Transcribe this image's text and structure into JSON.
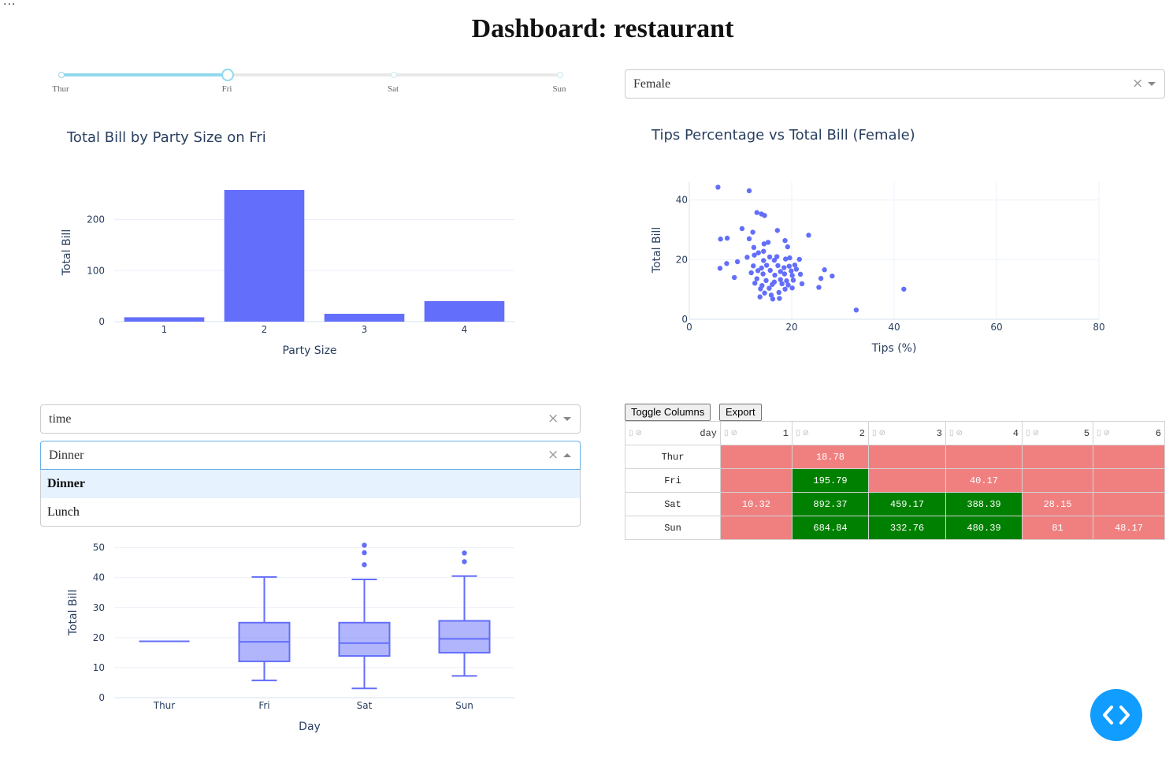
{
  "ellipsis": "...",
  "title": "Dashboard: restaurant",
  "day_slider": {
    "marks": [
      "Thur",
      "Fri",
      "Sat",
      "Sun"
    ],
    "selected": "Fri"
  },
  "sex_dropdown": {
    "value": "Female",
    "clear": "×"
  },
  "time_dropdown": {
    "value": "time",
    "clear": "×"
  },
  "meal_dropdown": {
    "value": "Dinner",
    "clear": "×",
    "options": [
      "Dinner",
      "Lunch"
    ],
    "highlighted": "Dinner"
  },
  "colors": {
    "bar": "#636efa",
    "positive": "#008000",
    "negative": "#f08080",
    "accent": "#119dff"
  },
  "charts": {
    "bar": {
      "type": "bar",
      "title": "Total Bill by Party Size on Fri",
      "xlabel": "Party Size",
      "ylabel": "Total Bill",
      "categories": [
        "1",
        "2",
        "3",
        "4"
      ],
      "values": [
        8.6,
        258,
        15.4,
        40.2
      ],
      "ylim": [
        0,
        258
      ],
      "yticks": [
        0,
        100,
        200
      ]
    },
    "scatter": {
      "type": "scatter",
      "title": "Tips Percentage vs Total Bill (Female)",
      "xlabel": "Tips (%)",
      "ylabel": "Total Bill",
      "xlim": [
        0,
        80
      ],
      "ylim": [
        0,
        46
      ],
      "xticks": [
        0,
        20,
        40,
        60,
        80
      ],
      "yticks": [
        0,
        20,
        40
      ],
      "points": [
        [
          5.6,
          44.3
        ],
        [
          11.7,
          43.1
        ],
        [
          13.2,
          35.8
        ],
        [
          14.1,
          35.3
        ],
        [
          14.7,
          34.8
        ],
        [
          10.3,
          30.4
        ],
        [
          12.4,
          29.2
        ],
        [
          17.2,
          29.8
        ],
        [
          23.3,
          28.2
        ],
        [
          6.1,
          26.9
        ],
        [
          7.4,
          27.2
        ],
        [
          11.7,
          27.0
        ],
        [
          14.6,
          25.3
        ],
        [
          15.4,
          25.8
        ],
        [
          18.7,
          26.4
        ],
        [
          12.6,
          24.1
        ],
        [
          19.2,
          24.3
        ],
        [
          13.5,
          22.3
        ],
        [
          14.5,
          22.8
        ],
        [
          11.3,
          20.8
        ],
        [
          12.7,
          21.5
        ],
        [
          15.7,
          20.9
        ],
        [
          17.1,
          21.0
        ],
        [
          19.6,
          20.6
        ],
        [
          14.5,
          19.7
        ],
        [
          16.6,
          19.8
        ],
        [
          18.8,
          20.2
        ],
        [
          21.5,
          20.1
        ],
        [
          7.3,
          18.7
        ],
        [
          9.4,
          19.3
        ],
        [
          6.0,
          17.1
        ],
        [
          12.5,
          17.9
        ],
        [
          14.1,
          17.2
        ],
        [
          15.1,
          18.1
        ],
        [
          17.3,
          18.0
        ],
        [
          18.5,
          17.3
        ],
        [
          19.5,
          17.8
        ],
        [
          20.6,
          18.2
        ],
        [
          13.4,
          16.3
        ],
        [
          15.8,
          16.4
        ],
        [
          17.8,
          16.0
        ],
        [
          19.9,
          16.2
        ],
        [
          20.9,
          16.8
        ],
        [
          26.4,
          16.6
        ],
        [
          8.8,
          14.0
        ],
        [
          12.1,
          15.6
        ],
        [
          14.4,
          15.2
        ],
        [
          16.7,
          14.8
        ],
        [
          18.6,
          15.2
        ],
        [
          20.1,
          14.7
        ],
        [
          21.7,
          15.1
        ],
        [
          27.9,
          14.5
        ],
        [
          25.7,
          13.7
        ],
        [
          13.2,
          13.6
        ],
        [
          15.0,
          13.0
        ],
        [
          16.6,
          12.5
        ],
        [
          17.8,
          13.3
        ],
        [
          19.0,
          12.9
        ],
        [
          20.3,
          13.1
        ],
        [
          12.8,
          12.1
        ],
        [
          14.2,
          11.3
        ],
        [
          16.2,
          11.7
        ],
        [
          18.1,
          11.9
        ],
        [
          19.3,
          11.5
        ],
        [
          22.0,
          11.9
        ],
        [
          25.3,
          10.7
        ],
        [
          13.9,
          10.2
        ],
        [
          15.6,
          10.4
        ],
        [
          18.7,
          10.1
        ],
        [
          20.1,
          10.5
        ],
        [
          14.7,
          8.8
        ],
        [
          17.5,
          9.0
        ],
        [
          13.8,
          7.5
        ],
        [
          16.0,
          8.1
        ],
        [
          17.6,
          7.0
        ],
        [
          16.3,
          6.8
        ],
        [
          32.6,
          3.1
        ],
        [
          41.9,
          10.1
        ]
      ]
    },
    "box": {
      "type": "box",
      "xlabel": "Day",
      "ylabel": "Total Bill",
      "categories": [
        "Thur",
        "Fri",
        "Sat",
        "Sun"
      ],
      "ylim": [
        0,
        52
      ],
      "yticks": [
        0,
        10,
        20,
        30,
        40,
        50
      ],
      "boxes": [
        {
          "min": 18.78,
          "q1": 18.78,
          "median": 18.78,
          "q3": 18.78,
          "max": 18.78,
          "outliers": []
        },
        {
          "min": 5.75,
          "q1": 12.1,
          "median": 18.6,
          "q3": 25.0,
          "max": 40.2,
          "outliers": []
        },
        {
          "min": 3.07,
          "q1": 13.9,
          "median": 18.2,
          "q3": 25.0,
          "max": 39.4,
          "outliers": [
            44.3,
            48.3,
            50.8
          ]
        },
        {
          "min": 7.25,
          "q1": 15.0,
          "median": 19.6,
          "q3": 25.6,
          "max": 40.5,
          "outliers": [
            45.3,
            48.2
          ]
        }
      ]
    }
  },
  "table": {
    "toggle_label": "Toggle Columns",
    "export_label": "Export",
    "columns": [
      "day",
      "1",
      "2",
      "3",
      "4",
      "5",
      "6"
    ],
    "rows": [
      {
        "day": "Thur",
        "cells": [
          "",
          "18.78",
          "",
          "",
          "",
          ""
        ]
      },
      {
        "day": "Fri",
        "cells": [
          "",
          "195.79",
          "",
          "40.17",
          "",
          ""
        ]
      },
      {
        "day": "Sat",
        "cells": [
          "10.32",
          "892.37",
          "459.17",
          "388.39",
          "28.15",
          ""
        ]
      },
      {
        "day": "Sun",
        "cells": [
          "",
          "684.84",
          "332.76",
          "480.39",
          "81",
          "48.17"
        ]
      }
    ]
  }
}
